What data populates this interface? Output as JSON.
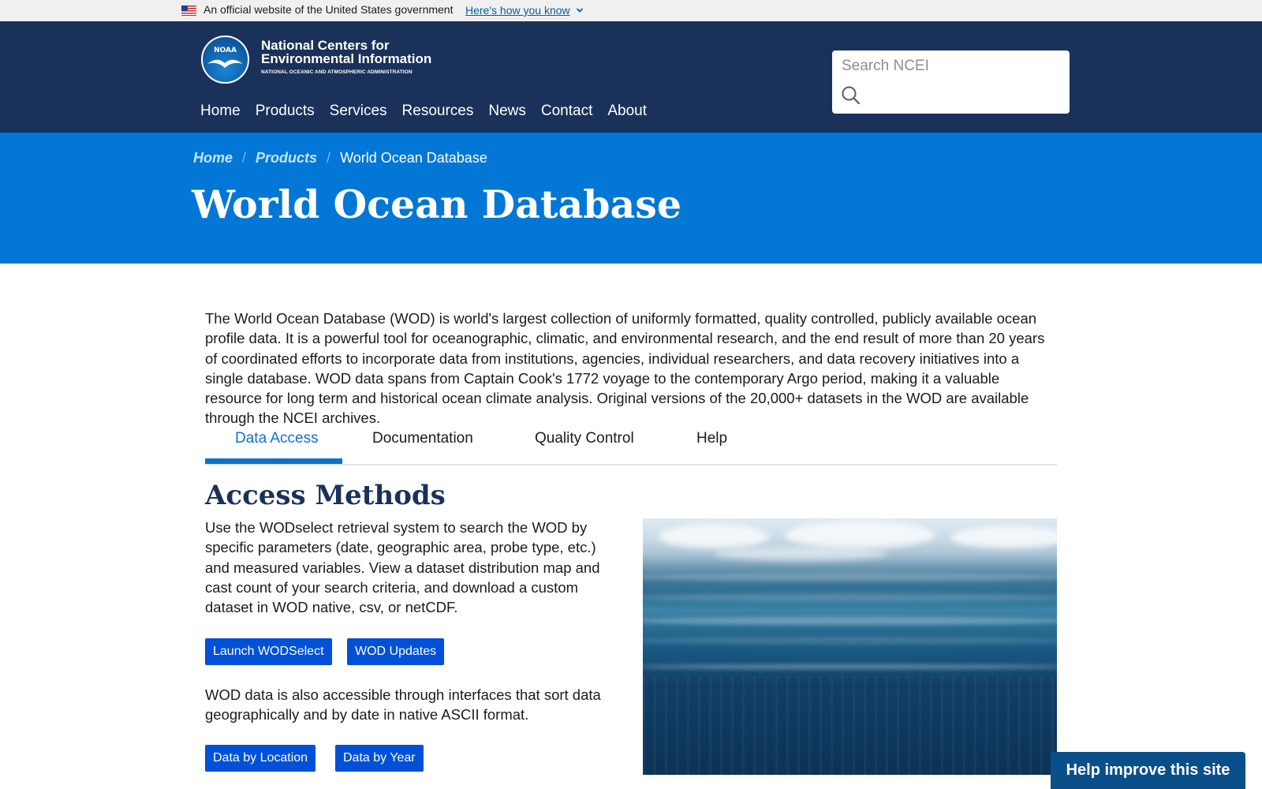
{
  "gov_banner": {
    "text": "An official website of the United States government",
    "link": "Here's how you know",
    "icons": {
      "flag": "us-flag-icon",
      "chevron": "chevron-down-icon"
    }
  },
  "header": {
    "logo": {
      "word": "NOAA",
      "icon": "noaa-logo-icon"
    },
    "title": "National Centers for Environmental Information",
    "subtitle": "NATIONAL OCEANIC AND ATMOSPHERIC ADMINISTRATION",
    "nav": [
      "Home",
      "Products",
      "Services",
      "Resources",
      "News",
      "Contact",
      "About"
    ],
    "search": {
      "placeholder": "Search NCEI",
      "value": "",
      "icon": "search-icon"
    }
  },
  "hero": {
    "breadcrumb": {
      "home": "Home",
      "products": "Products",
      "current": "World Ocean Database",
      "separator": "/"
    },
    "title": "World Ocean Database"
  },
  "main": {
    "intro": "The World Ocean Database (WOD) is world's largest collection of uniformly formatted, quality controlled, publicly available ocean profile data. It is a powerful tool for oceanographic, climatic, and environmental research, and the end result of more than 20 years of coordinated efforts to incorporate data from institutions, agencies, individual researchers, and data recovery initiatives into a single database. WOD data spans from Captain Cook's 1772 voyage to the contemporary Argo period, making it a valuable resource for long term and historical ocean climate analysis. Original versions of the 20,000+ datasets in the WOD are available through the NCEI archives.",
    "tabs": [
      "Data Access",
      "Documentation",
      "Quality Control",
      "Help"
    ],
    "active_tab": "Data Access",
    "section_title": "Access Methods",
    "para1": "Use the WODselect retrieval system to search the WOD by specific parameters (date, geographic area, probe type, etc.) and measured variables. View a dataset distribution map and cast count of your search criteria, and download a custom dataset in WOD native, csv, or netCDF.",
    "buttons1": [
      "Launch WODSelect",
      "WOD Updates"
    ],
    "para2": "WOD data is also accessible through interfaces that sort data geographically and by date in native ASCII format.",
    "buttons2": [
      "Data by Location",
      "Data by Year"
    ]
  },
  "feedback_button": "Help improve this site",
  "colors": {
    "header_bg": "#1a3159",
    "hero_bg": "#0277d6",
    "button_bg": "#0050d8",
    "active_tab": "#0f73c9",
    "section_title": "#1a3159"
  }
}
